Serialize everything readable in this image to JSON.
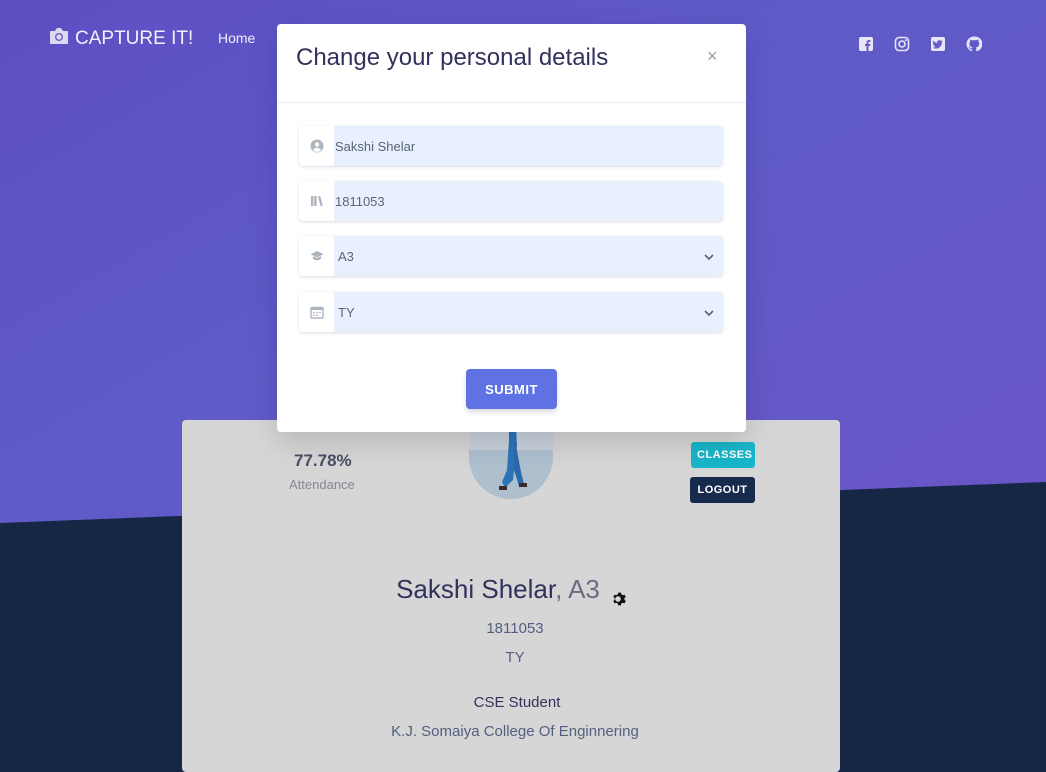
{
  "nav": {
    "brand": "CAPTURE IT!",
    "home_label": "Home",
    "social_icons": [
      "facebook-icon",
      "instagram-icon",
      "twitter-icon",
      "github-icon"
    ]
  },
  "modal": {
    "title": "Change your personal details",
    "close_symbol": "×",
    "fields": {
      "name": "Sakshi Shelar",
      "roll": "1811053",
      "division": "A3",
      "year": "TY"
    },
    "submit_label": "SUBMIT"
  },
  "profile": {
    "attendance_value": "77.78%",
    "attendance_label": "Attendance",
    "classes_label": "CLASSES",
    "logout_label": "LOGOUT",
    "name": "Sakshi Shelar",
    "division_suffix": ", A3",
    "roll": "1811053",
    "year": "TY",
    "role": "CSE Student",
    "college": "K.J. Somaiya College Of Enginnering"
  },
  "colors": {
    "hero_gradient_start": "#5e4fc2",
    "hero_gradient_end": "#6a55c6",
    "dark_background": "#152745",
    "submit_button": "#5e72e4",
    "classes_button": "#18b6c9",
    "logout_button": "#172b4d",
    "field_background": "#e8f0fe"
  }
}
